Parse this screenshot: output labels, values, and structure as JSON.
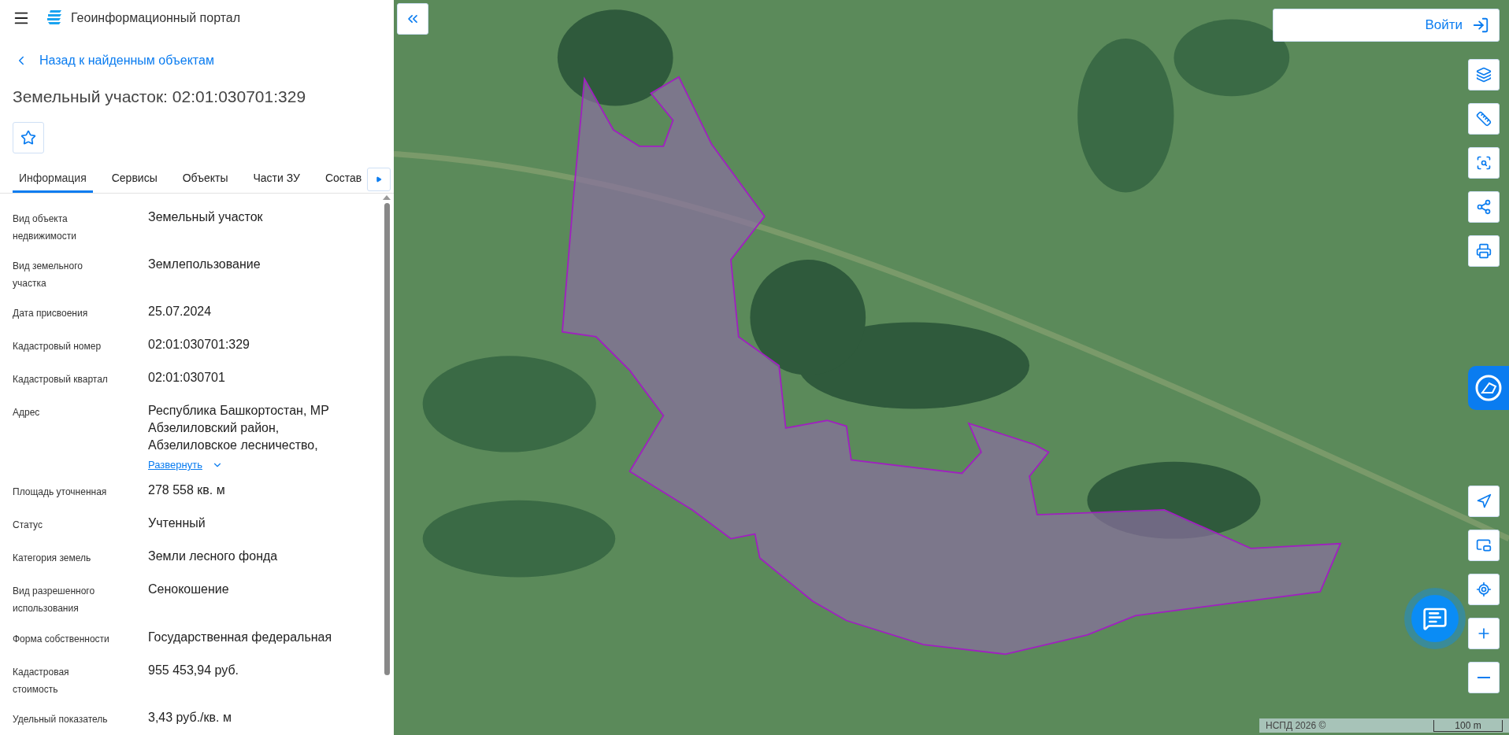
{
  "header": {
    "title": "Геоинформационный портал"
  },
  "back_link": "Назад к найденным объектам",
  "object_title": "Земельный участок: 02:01:030701:329",
  "tabs": [
    {
      "label": "Информация",
      "selected": true
    },
    {
      "label": "Сервисы",
      "selected": false
    },
    {
      "label": "Объекты",
      "selected": false
    },
    {
      "label": "Части ЗУ",
      "selected": false
    },
    {
      "label": "Состав",
      "selected": false
    }
  ],
  "properties": [
    {
      "label": "Вид объекта недвижимости",
      "value": "Земельный участок"
    },
    {
      "label": "Вид земельного участка",
      "value": "Землепользование"
    },
    {
      "label": "Дата присвоения",
      "value": "25.07.2024"
    },
    {
      "label": "Кадастровый номер",
      "value": "02:01:030701:329"
    },
    {
      "label": "Кадастровый квартал",
      "value": "02:01:030701"
    },
    {
      "label": "Адрес",
      "value": "Республика Башкортостан, МР Абзелиловский район, Абзелиловское лесничество,",
      "expand_link": "Развернуть"
    },
    {
      "label": "Площадь уточненная",
      "value": "278 558 кв. м"
    },
    {
      "label": "Статус",
      "value": "Учтенный"
    },
    {
      "label": "Категория земель",
      "value": "Земли лесного фонда"
    },
    {
      "label": "Вид разрешенного использования",
      "value": "Сенокошение"
    },
    {
      "label": "Форма собственности",
      "value": "Государственная федеральная"
    },
    {
      "label": "Кадастровая стоимость",
      "value": "955 453,94 руб."
    },
    {
      "label": "Удельный показатель",
      "value": "3,43 руб./кв. м"
    }
  ],
  "login_button": "Войти",
  "map_tools_top": [
    {
      "kind": "layers"
    },
    {
      "kind": "ruler"
    },
    {
      "kind": "select"
    },
    {
      "kind": "share"
    },
    {
      "kind": "print"
    }
  ],
  "map_tools_bottom": [
    {
      "kind": "locate"
    },
    {
      "kind": "minimap"
    },
    {
      "kind": "search"
    },
    {
      "kind": "zoom_in"
    },
    {
      "kind": "zoom_out"
    }
  ],
  "attribution": "НСПД 2026 ©",
  "scale": "100 m"
}
